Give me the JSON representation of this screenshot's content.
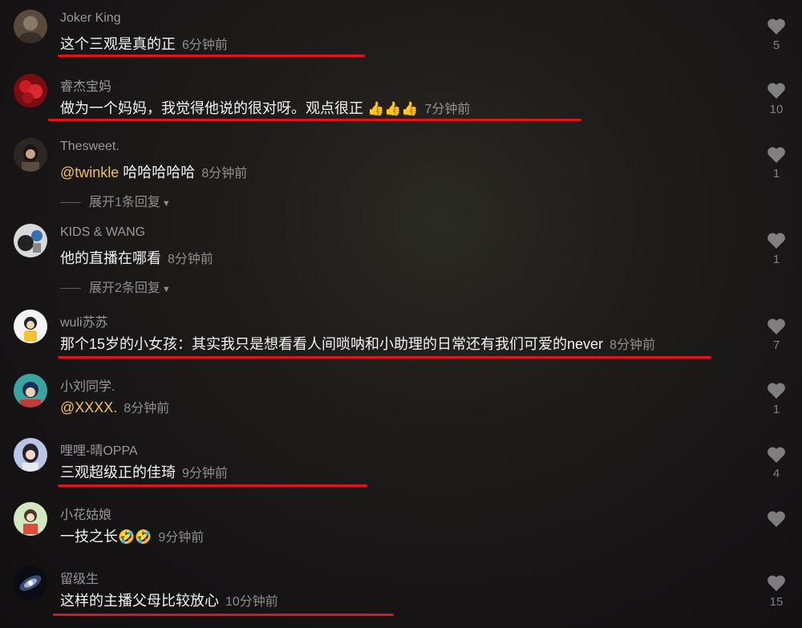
{
  "comments": [
    {
      "username": "Joker King",
      "text": "这个三观是真的正",
      "time": "6分钟前",
      "likes": "5"
    },
    {
      "username": "睿杰宝妈",
      "text": "做为一个妈妈，我觉得他说的很对呀。观点很正",
      "emoji": "👍👍👍",
      "time": "7分钟前",
      "likes": "10"
    },
    {
      "username": "Thesweet.",
      "mention": "@twinkle",
      "text": " 哈哈哈哈哈",
      "time": "8分钟前",
      "likes": "1",
      "expand": "展开1条回复"
    },
    {
      "username": "KIDS & WANG",
      "text": "他的直播在哪看",
      "time": "8分钟前",
      "likes": "1",
      "expand": "展开2条回复"
    },
    {
      "username": "wuli苏苏",
      "text": "那个15岁的小女孩：其实我只是想看看人间唢呐和小助理的日常还有我们可爱的never",
      "time": "8分钟前",
      "likes": "7"
    },
    {
      "username": "小刘同学.",
      "mention": "@XXXX.",
      "time": "8分钟前",
      "likes": "1"
    },
    {
      "username": "哩哩-晴OPPA",
      "text": "三观超级正的佳琦",
      "time": "9分钟前",
      "likes": "4"
    },
    {
      "username": "小花姑娘",
      "text": "一技之长",
      "emoji": "🤣🤣",
      "time": "9分钟前",
      "likes": ""
    },
    {
      "username": "留级生",
      "text": "这样的主播父母比较放心",
      "time": "10分钟前",
      "likes": "15"
    }
  ],
  "colors": {
    "mention": "#f2c14e",
    "underline": "#e3121b"
  }
}
